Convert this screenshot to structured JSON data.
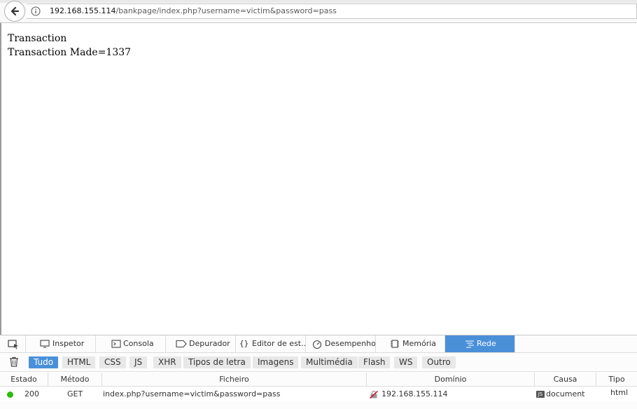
{
  "browser": {
    "url": {
      "host": "192.168.155.114",
      "path": "/bankpage/index.php?username=victim&password=pass"
    }
  },
  "page": {
    "lines": [
      "Transaction",
      "Transaction Made=1337"
    ]
  },
  "devtools": {
    "tabs": [
      {
        "label": "Inspetor",
        "icon": "inspector-icon"
      },
      {
        "label": "Consola",
        "icon": "console-icon"
      },
      {
        "label": "Depurador",
        "icon": "debugger-icon"
      },
      {
        "label": "Editor de est...",
        "icon": "style-editor-icon"
      },
      {
        "label": "Desempenho",
        "icon": "performance-icon"
      },
      {
        "label": "Memória",
        "icon": "memory-icon"
      },
      {
        "label": "Rede",
        "icon": "network-icon",
        "active": true
      }
    ],
    "filters": [
      "Tudo",
      "HTML",
      "CSS",
      "JS",
      "XHR",
      "Tipos de letra",
      "Imagens",
      "Multimédia",
      "Flash",
      "WS",
      "Outro"
    ],
    "active_filter": "Tudo",
    "columns": [
      "Estado",
      "Método",
      "Ficheiro",
      "Domínio",
      "Causa",
      "Tipo"
    ],
    "requests": [
      {
        "status": "200",
        "method": "GET",
        "file": "index.php?username=victim&password=pass",
        "domain": "192.168.155.114",
        "cause": "document",
        "type": "html",
        "status_color": "#2cbb0f"
      }
    ]
  },
  "colors": {
    "accent": "#4a90d9"
  }
}
